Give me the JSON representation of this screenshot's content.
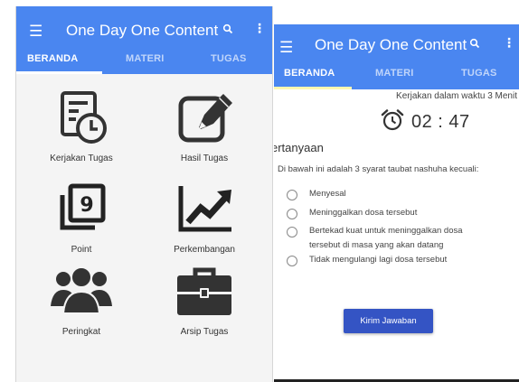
{
  "left_screen": {
    "app_title": "One Day One Content",
    "tabs": [
      {
        "label": "BERANDA",
        "active": true
      },
      {
        "label": "MATERI",
        "active": false
      },
      {
        "label": "TUGAS",
        "active": false
      }
    ],
    "menu_items": [
      {
        "label": "Kerjakan Tugas",
        "icon": "task-clock-icon"
      },
      {
        "label": "Hasil Tugas",
        "icon": "edit-pencil-icon"
      },
      {
        "label": "Point",
        "icon": "point-nine-icon"
      },
      {
        "label": "Perkembangan",
        "icon": "trend-chart-icon"
      },
      {
        "label": "Peringkat",
        "icon": "group-users-icon"
      },
      {
        "label": "Arsip Tugas",
        "icon": "briefcase-icon"
      }
    ]
  },
  "right_screen": {
    "app_title": "One Day One Content",
    "tabs": [
      {
        "label": "BERANDA",
        "active": true
      },
      {
        "label": "MATERI",
        "active": false
      },
      {
        "label": "TUGAS",
        "active": false
      }
    ],
    "timer_note": "Kerjakan dalam waktu 3  Menit",
    "timer_value": "02 : 47",
    "section_heading": "ertanyaan",
    "question": "Di bawah ini adalah 3 syarat taubat nashuha kecuali:",
    "options": [
      "Menyesal",
      "Meninggalkan dosa tersebut",
      "Bertekad kuat untuk meninggalkan dosa tersebut di masa yang akan datang",
      "Tidak mengulangi lagi dosa tersebut"
    ],
    "submit_label": "Kirim Jawaban"
  },
  "colors": {
    "app_bar": "#4a86f0",
    "button": "#3454c4",
    "background_left": "#f4f4f4"
  }
}
